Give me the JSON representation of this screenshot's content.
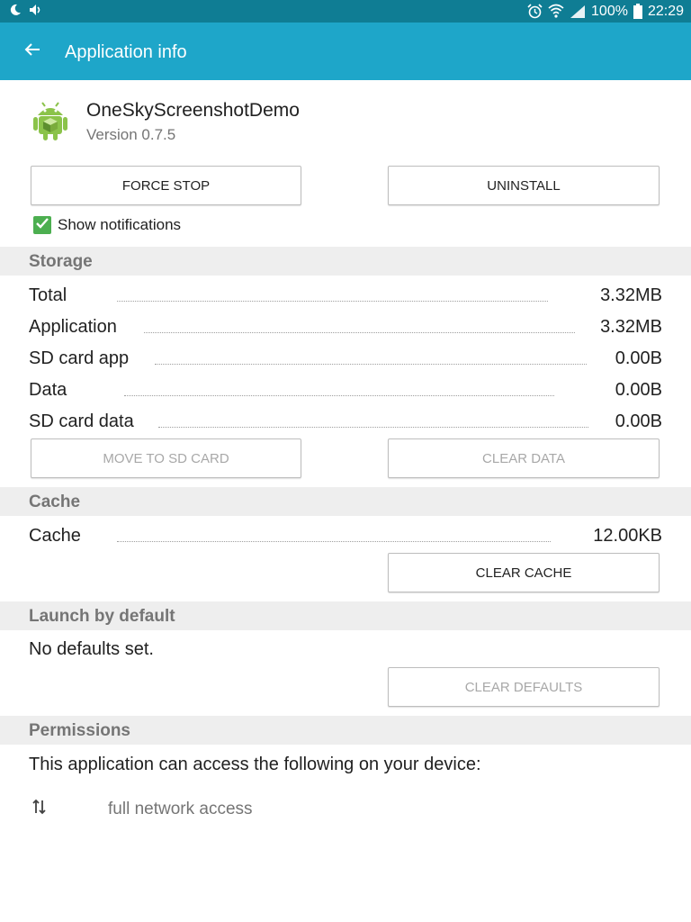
{
  "status_bar": {
    "left_icons": [
      "moon-icon",
      "volume-icon"
    ],
    "right_icons": [
      "alarm-icon",
      "wifi-icon",
      "signal-icon",
      "battery-icon"
    ],
    "battery": "100%",
    "time": "22:29"
  },
  "app_bar": {
    "title": "Application info",
    "back_icon": "back-arrow-icon",
    "background_color": "#1ea6c9"
  },
  "app": {
    "icon": "android-app-icon",
    "name": "OneSkyScreenshotDemo",
    "version": "Version 0.7.5"
  },
  "actions": {
    "force_stop": "FORCE STOP",
    "uninstall": "UNINSTALL"
  },
  "notifications": {
    "label": "Show notifications",
    "checked": true,
    "check_color": "#4caf50"
  },
  "storage": {
    "header": "Storage",
    "rows": [
      {
        "label": "Total",
        "value": "3.32MB"
      },
      {
        "label": "Application",
        "value": "3.32MB"
      },
      {
        "label": "SD card app",
        "value": "0.00B"
      },
      {
        "label": "Data",
        "value": "0.00B"
      },
      {
        "label": "SD card data",
        "value": "0.00B"
      }
    ],
    "move_to_sd": "MOVE TO SD CARD",
    "clear_data": "CLEAR DATA"
  },
  "cache": {
    "header": "Cache",
    "label": "Cache",
    "value": "12.00KB",
    "clear_cache": "CLEAR CACHE"
  },
  "launch": {
    "header": "Launch by default",
    "text": "No defaults set.",
    "clear_defaults": "CLEAR DEFAULTS"
  },
  "permissions": {
    "header": "Permissions",
    "intro": "This application can access the following on your device:",
    "items": [
      {
        "icon": "network-arrows-icon",
        "label": "full network access"
      }
    ]
  }
}
